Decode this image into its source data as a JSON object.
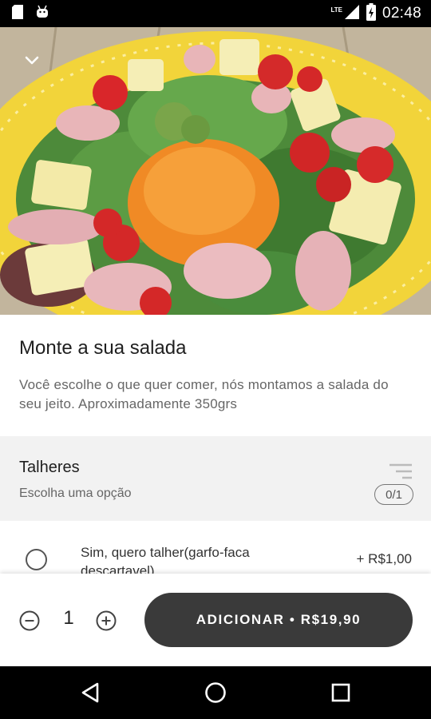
{
  "status_bar": {
    "time": "02:48",
    "network": "LTE",
    "icons": [
      "sd-card-icon",
      "android-icon",
      "signal-icon",
      "battery-icon"
    ]
  },
  "hero": {
    "image": "salad-photo",
    "back_icon": "chevron-down-icon"
  },
  "product": {
    "title": "Monte a sua salada",
    "description": "Você escolhe o que quer comer, nós montamos a salada do seu jeito.  Aproximadamente 350grs"
  },
  "option_group": {
    "title": "Talheres",
    "subtitle": "Escolha uma opção",
    "count": "0/1",
    "icon": "sort-icon",
    "options": [
      {
        "label": "Sim, quero talher(garfo-faca descartavel)",
        "price": "+ R$1,00",
        "selected": false
      }
    ]
  },
  "action_bar": {
    "quantity": "1",
    "add_label": "ADICIONAR • R$19,90",
    "minus_icon": "minus-circle-icon",
    "plus_icon": "plus-circle-icon"
  },
  "nav_bar": {
    "icons": [
      "back-triangle-icon",
      "home-circle-icon",
      "recents-square-icon"
    ]
  },
  "colors": {
    "button_bg": "#3a3a3a",
    "group_bg": "#f2f2f2",
    "plate_yellow": "#f2d43a"
  }
}
